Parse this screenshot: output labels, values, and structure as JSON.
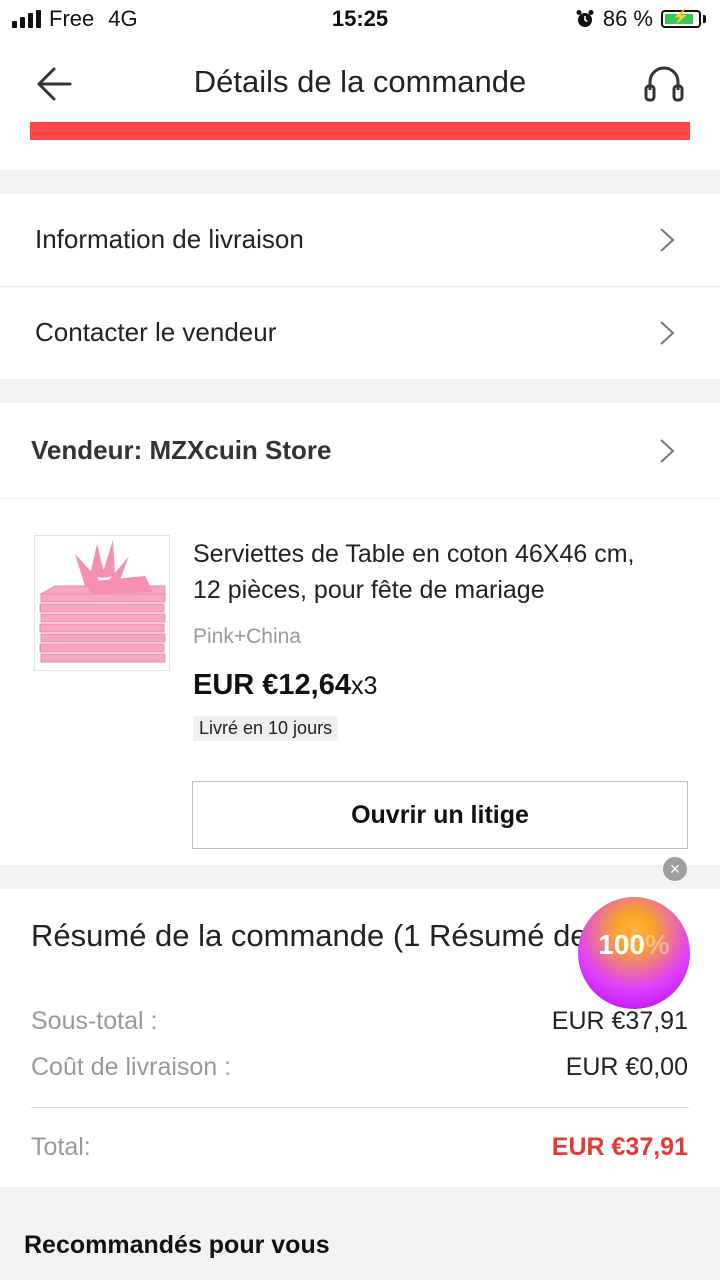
{
  "status_bar": {
    "carrier": "Free",
    "network": "4G",
    "time": "15:25",
    "battery": "86 %",
    "battery_level": 0.86,
    "icons": [
      "signal-icon",
      "alarm-icon",
      "battery-icon"
    ]
  },
  "header": {
    "title": "Détails de la commande",
    "back_icon": "arrow-left-icon",
    "support_icon": "headset-icon",
    "accent_color": "#ff4747"
  },
  "links": {
    "delivery_info": "Information de livraison",
    "contact_seller": "Contacter le vendeur"
  },
  "vendor": {
    "label": "Vendeur: MZXcuin Store"
  },
  "product": {
    "title_line1": "Serviettes de Table en coton 46X46 cm,",
    "title_line2": "12 pièces, pour fête de mariage",
    "variant": "Pink+China",
    "price": "EUR €12,64",
    "quantity": "x3",
    "delivery": "Livré en 10 jours",
    "dispute_button": "Ouvrir un litige"
  },
  "summary": {
    "title": "Résumé de la commande (1 Résumé de la commande)",
    "subtotal_label": "Sous-total :",
    "subtotal_value": "EUR €37,91",
    "shipping_label": "Coût de livraison :",
    "shipping_value": "EUR €0,00",
    "total_label": "Total:",
    "total_value": "EUR €37,91",
    "total_color": "#e53935"
  },
  "promo_badge": {
    "text": "100",
    "suffix": "%"
  },
  "recommendations": {
    "title": "Recommandés pour vous"
  }
}
